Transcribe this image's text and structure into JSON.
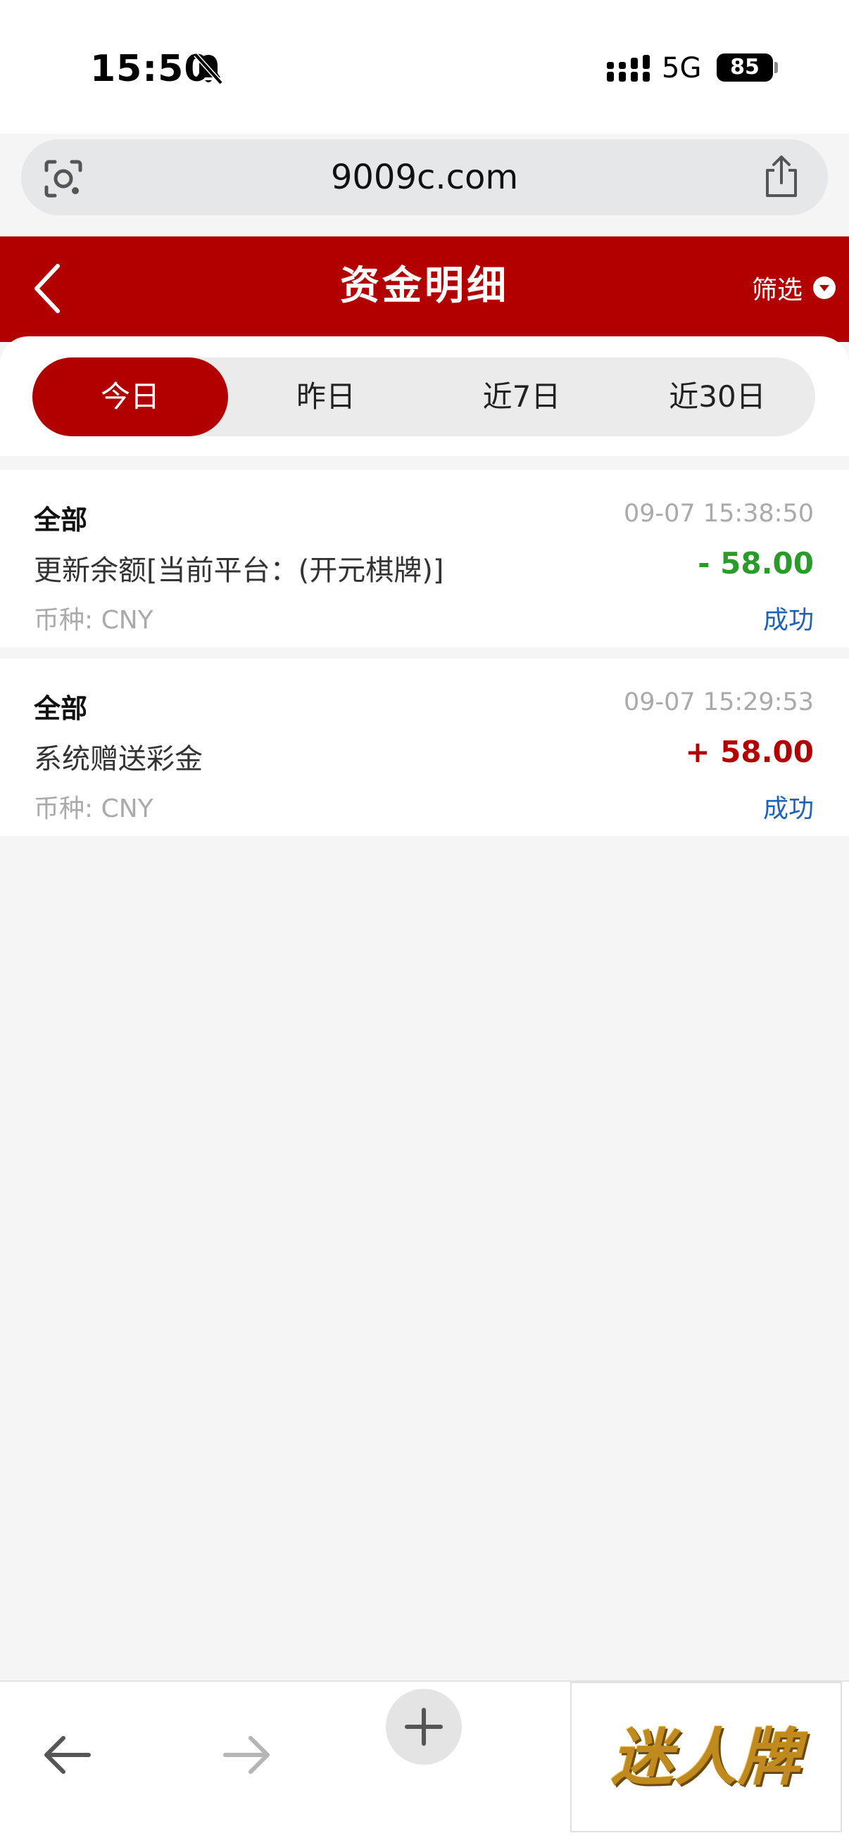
{
  "status_bar": {
    "time": "15:50",
    "network": "5G",
    "battery": "85",
    "icons": [
      "bell-muted-icon",
      "signal-icon",
      "battery-icon"
    ]
  },
  "browser": {
    "url": "9009c.com",
    "icons": [
      "camera-search-icon",
      "share-icon"
    ]
  },
  "header": {
    "title": "资金明细",
    "filter_label": "筛选",
    "icons": [
      "back-icon",
      "filter-dropdown-icon"
    ]
  },
  "tabs": [
    {
      "label": "今日",
      "active": true
    },
    {
      "label": "昨日",
      "active": false
    },
    {
      "label": "近7日",
      "active": false
    },
    {
      "label": "近30日",
      "active": false
    }
  ],
  "records": [
    {
      "type": "全部",
      "time": "09-07 15:38:50",
      "description": "更新余额[当前平台：(开元棋牌)]",
      "amount": "- 58.00",
      "amount_color": "#2a9a2a",
      "currency": "币种: CNY",
      "status": "成功"
    },
    {
      "type": "全部",
      "time": "09-07 15:29:53",
      "description": "系统赠送彩金",
      "amount": "+ 58.00",
      "amount_color": "#b20000",
      "currency": "币种: CNY",
      "status": "成功"
    }
  ],
  "bottom_bar": {
    "icons": [
      "nav-back-icon",
      "nav-forward-icon",
      "plus-icon"
    ],
    "ad_text": "迷人牌"
  },
  "colors": {
    "brand": "#b20000",
    "status_blue": "#1f63b8",
    "negative_green": "#2a9a2a"
  }
}
